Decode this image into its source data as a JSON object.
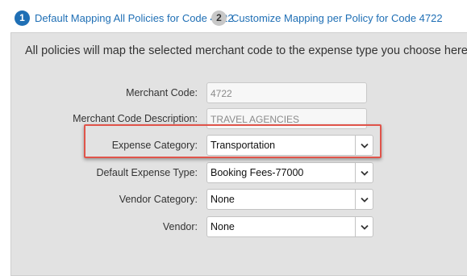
{
  "tabs": [
    {
      "number": "1",
      "label": "Default Mapping All Policies for Code 4722",
      "active": true
    },
    {
      "number": "2",
      "label": "Customize Mapping per Policy for Code 4722",
      "active": false
    }
  ],
  "intro_text": "All policies will map the selected merchant code to the expense type you choose here.",
  "form": {
    "merchant_code": {
      "label": "Merchant Code:",
      "value": "4722"
    },
    "merchant_code_description": {
      "label": "Merchant Code Description:",
      "value": "TRAVEL AGENCIES"
    },
    "expense_category": {
      "label": "Expense Category:",
      "value": "Transportation"
    },
    "default_expense_type": {
      "label": "Default Expense Type:",
      "value": "Booking Fees-77000"
    },
    "vendor_category": {
      "label": "Vendor Category:",
      "value": "None"
    },
    "vendor": {
      "label": "Vendor:",
      "value": "None"
    }
  },
  "icons": {
    "dropdown": "chevron-down-icon"
  },
  "colors": {
    "accent": "#1f6fb5",
    "highlight": "#e0544a",
    "panel": "#e2e2e2"
  }
}
